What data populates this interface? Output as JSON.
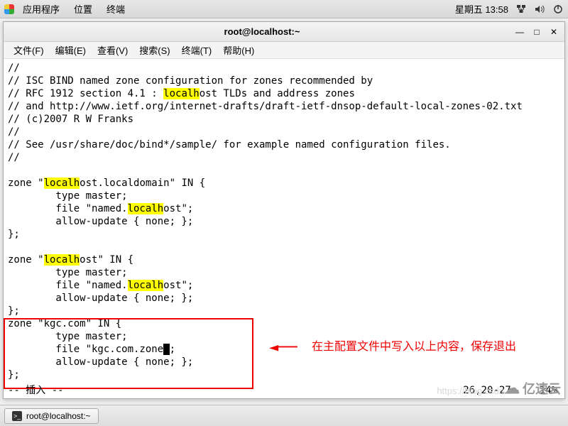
{
  "topbar": {
    "menus": [
      "应用程序",
      "位置",
      "终端"
    ],
    "datetime": "星期五 13:58"
  },
  "window": {
    "title": "root@localhost:~"
  },
  "menubar": {
    "items": [
      "文件(F)",
      "编辑(E)",
      "查看(V)",
      "搜索(S)",
      "终端(T)",
      "帮助(H)"
    ]
  },
  "terminal": {
    "lines": [
      "//",
      "// ISC BIND named zone configuration for zones recommended by",
      "// RFC 1912 section 4.1 : localhost TLDs and address zones",
      "// and http://www.ietf.org/internet-drafts/draft-ietf-dnsop-default-local-zones-02.txt",
      "// (c)2007 R W Franks",
      "//",
      "// See /usr/share/doc/bind*/sample/ for example named configuration files.",
      "//",
      "",
      "zone \"localhost.localdomain\" IN {",
      "        type master;",
      "        file \"named.localhost\";",
      "        allow-update { none; };",
      "};",
      "",
      "zone \"localhost\" IN {",
      "        type master;",
      "        file \"named.localhost\";",
      "        allow-update { none; };",
      "};",
      "zone \"kgc.com\" IN {",
      "        type master;",
      "        file \"kgc.com.zone\";",
      "        allow-update { none; };",
      "};"
    ],
    "status_mode": "-- 插入 --",
    "status_pos": "26,20-27",
    "status_pct": "14%"
  },
  "annotation": {
    "text": "在主配置文件中写入以上内容，保存退出"
  },
  "taskbar": {
    "task": "root@localhost:~"
  },
  "watermark": "亿速云",
  "blog_wm": "https://blog.csdn"
}
